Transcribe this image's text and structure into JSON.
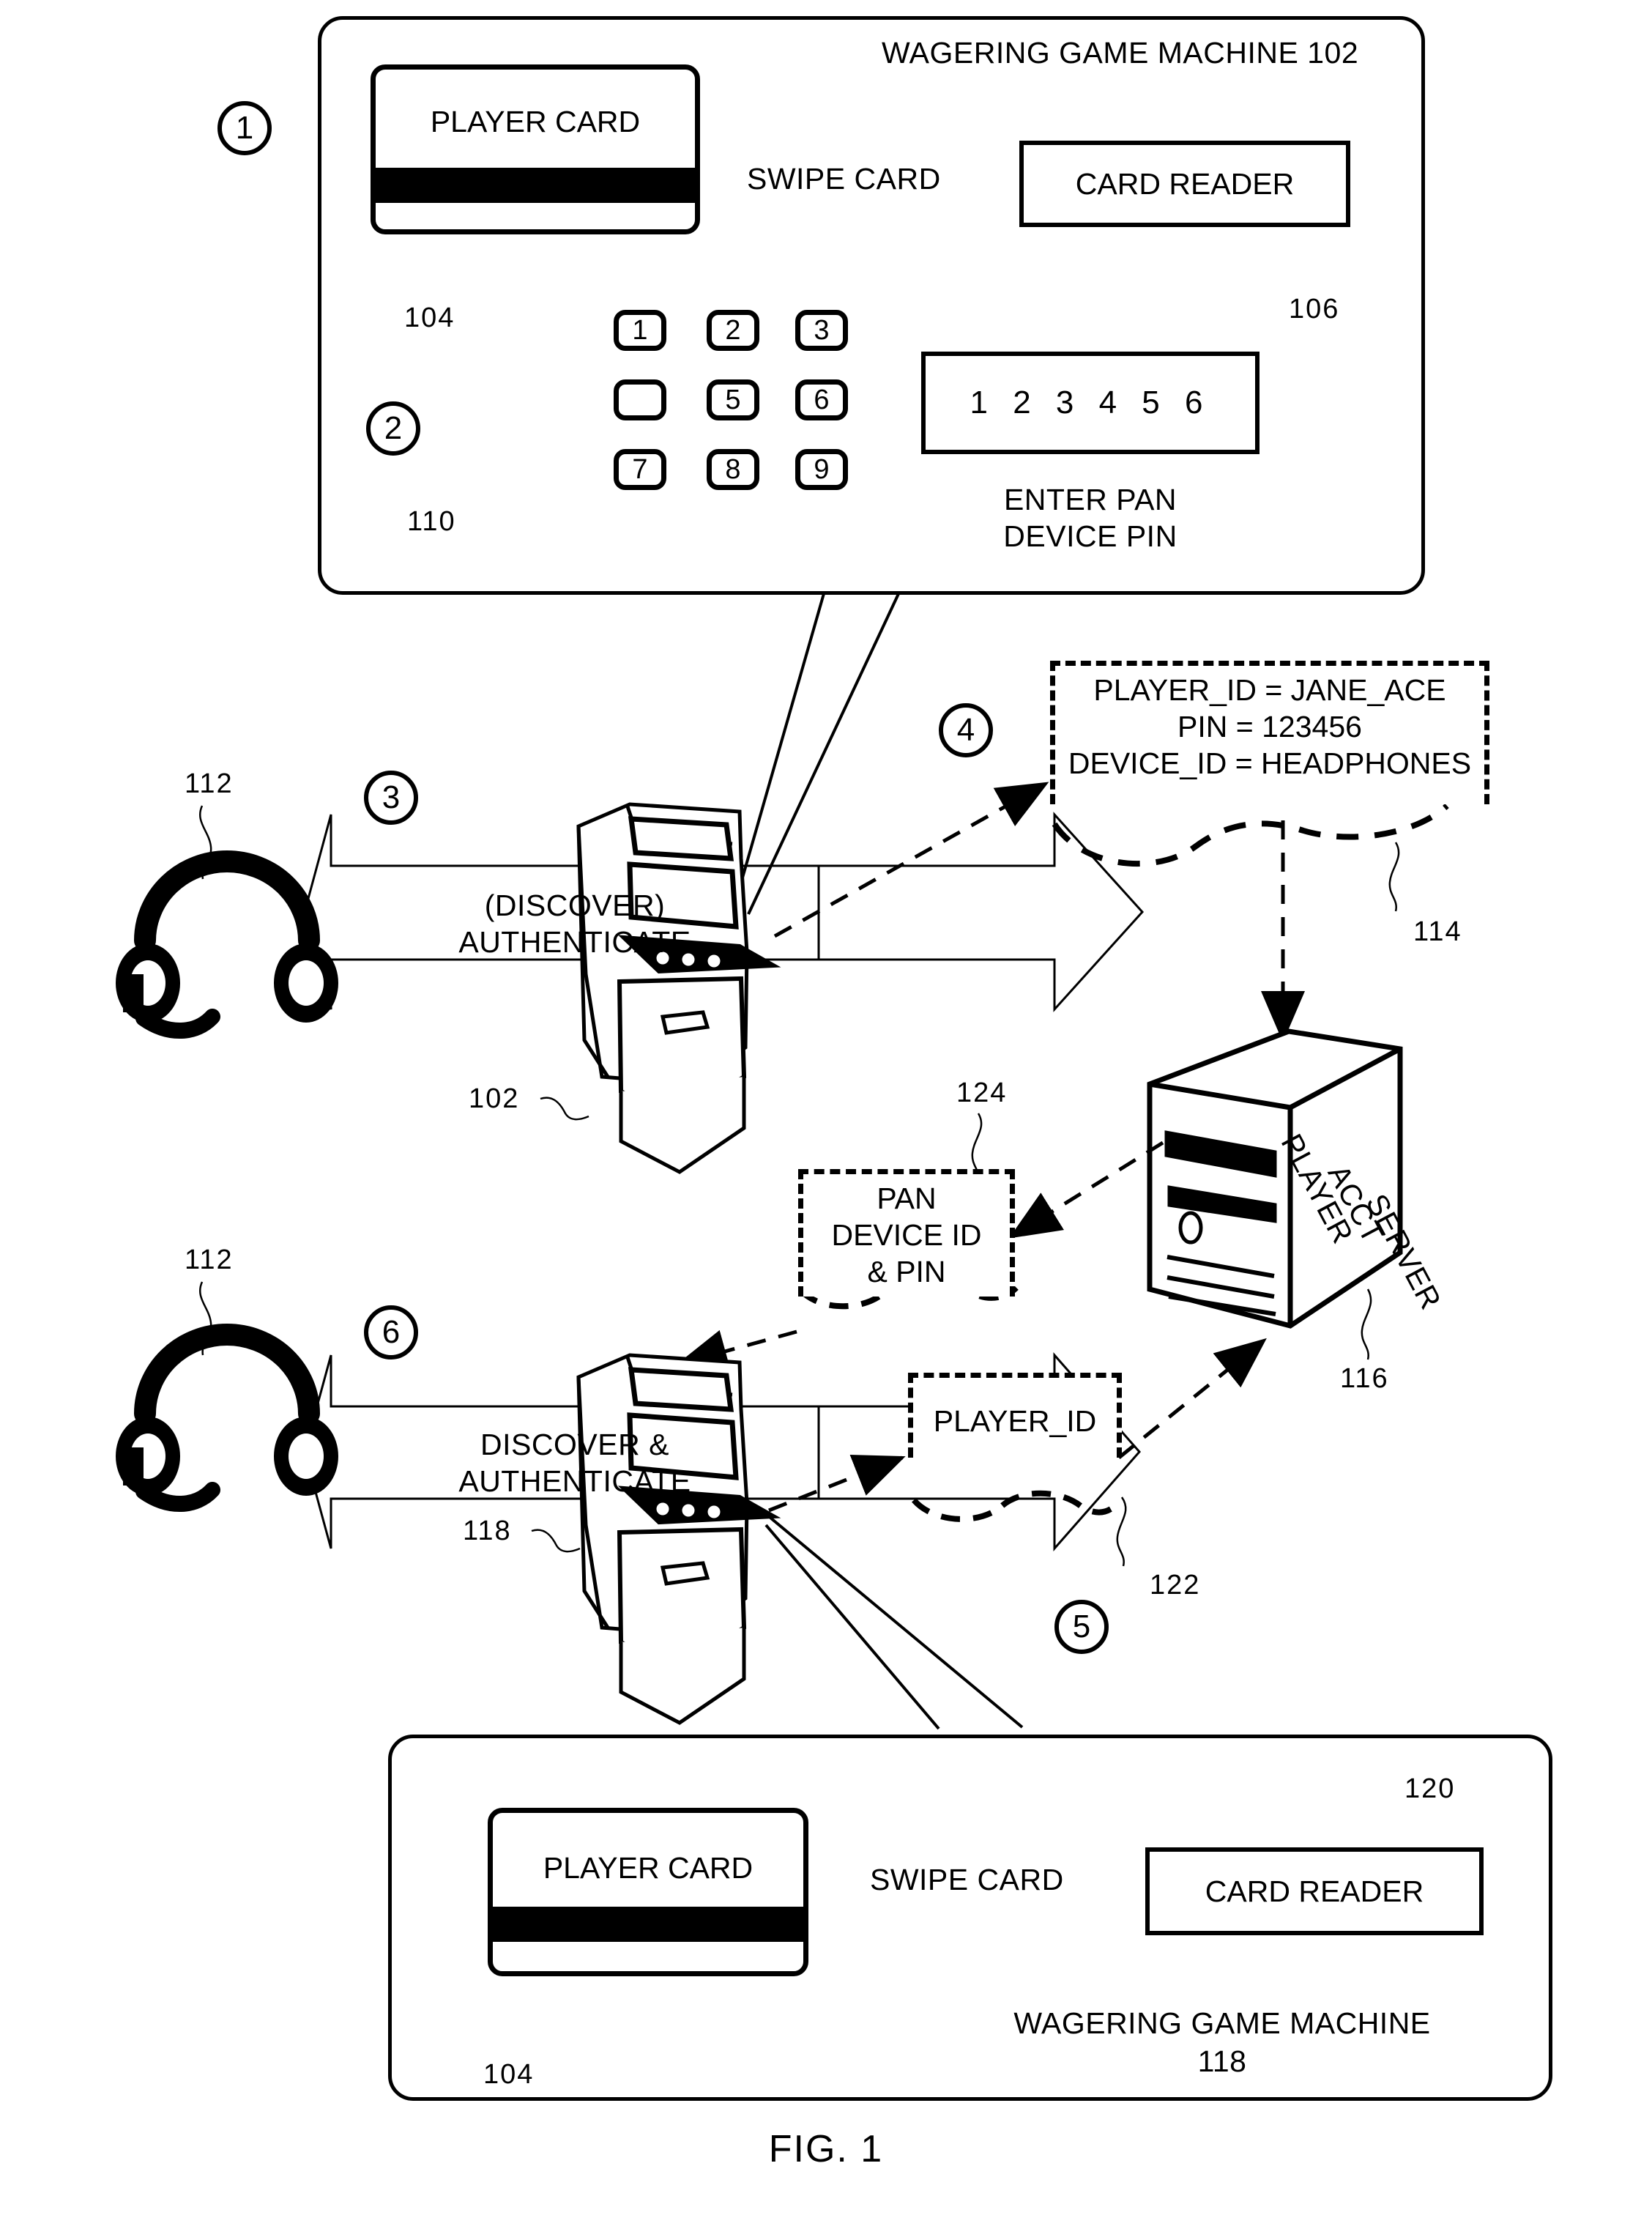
{
  "figure": {
    "caption": "FIG. 1"
  },
  "top_machine": {
    "title": "WAGERING GAME MACHINE 102",
    "card": {
      "label": "PLAYER CARD",
      "ref": "104"
    },
    "swipe_arrow_label": "SWIPE CARD",
    "card_reader": {
      "label": "CARD READER",
      "ref": "106"
    },
    "keypad": {
      "ref": "110",
      "keys": [
        "1",
        "2",
        "3",
        "5",
        "6",
        "7",
        "8",
        "9"
      ],
      "pressed_key": "1"
    },
    "pin_display": {
      "value": "1 2 3 4 5 6",
      "caption_line1": "ENTER PAN",
      "caption_line2": "DEVICE PIN"
    }
  },
  "steps": {
    "s1": "1",
    "s2": "2",
    "s3": "3",
    "s4": "4",
    "s5": "5",
    "s6": "6"
  },
  "step3": {
    "headphones_ref": "112",
    "arrow_line1": "(DISCOVER)",
    "arrow_line2": "AUTHENTICATE",
    "machine_ref": "102"
  },
  "credentials_box": {
    "line1": "PLAYER_ID = JANE_ACE",
    "line2": "PIN = 123456",
    "line3": "DEVICE_ID = HEADPHONES",
    "ref": "114"
  },
  "server": {
    "label_line1": "PLAYER",
    "label_line2": "ACCT",
    "label_line3": "SERVER",
    "ref": "116"
  },
  "pan_device_box": {
    "line1": "PAN",
    "line2": "DEVICE ID",
    "line3": "& PIN",
    "ref": "124"
  },
  "player_id_box": {
    "label": "PLAYER_ID",
    "ref": "122"
  },
  "step6": {
    "headphones_ref": "112",
    "arrow_line1": "DISCOVER &",
    "arrow_line2": "AUTHENTICATE",
    "machine_ref": "118"
  },
  "bottom_machine": {
    "card": {
      "label": "PLAYER CARD",
      "ref": "104"
    },
    "swipe_arrow_label": "SWIPE CARD",
    "card_reader": {
      "label": "CARD READER",
      "ref": "120"
    },
    "title_line1": "WAGERING GAME MACHINE",
    "title_line2": "118"
  },
  "colors": {
    "ink": "#000000",
    "paper": "#ffffff"
  }
}
